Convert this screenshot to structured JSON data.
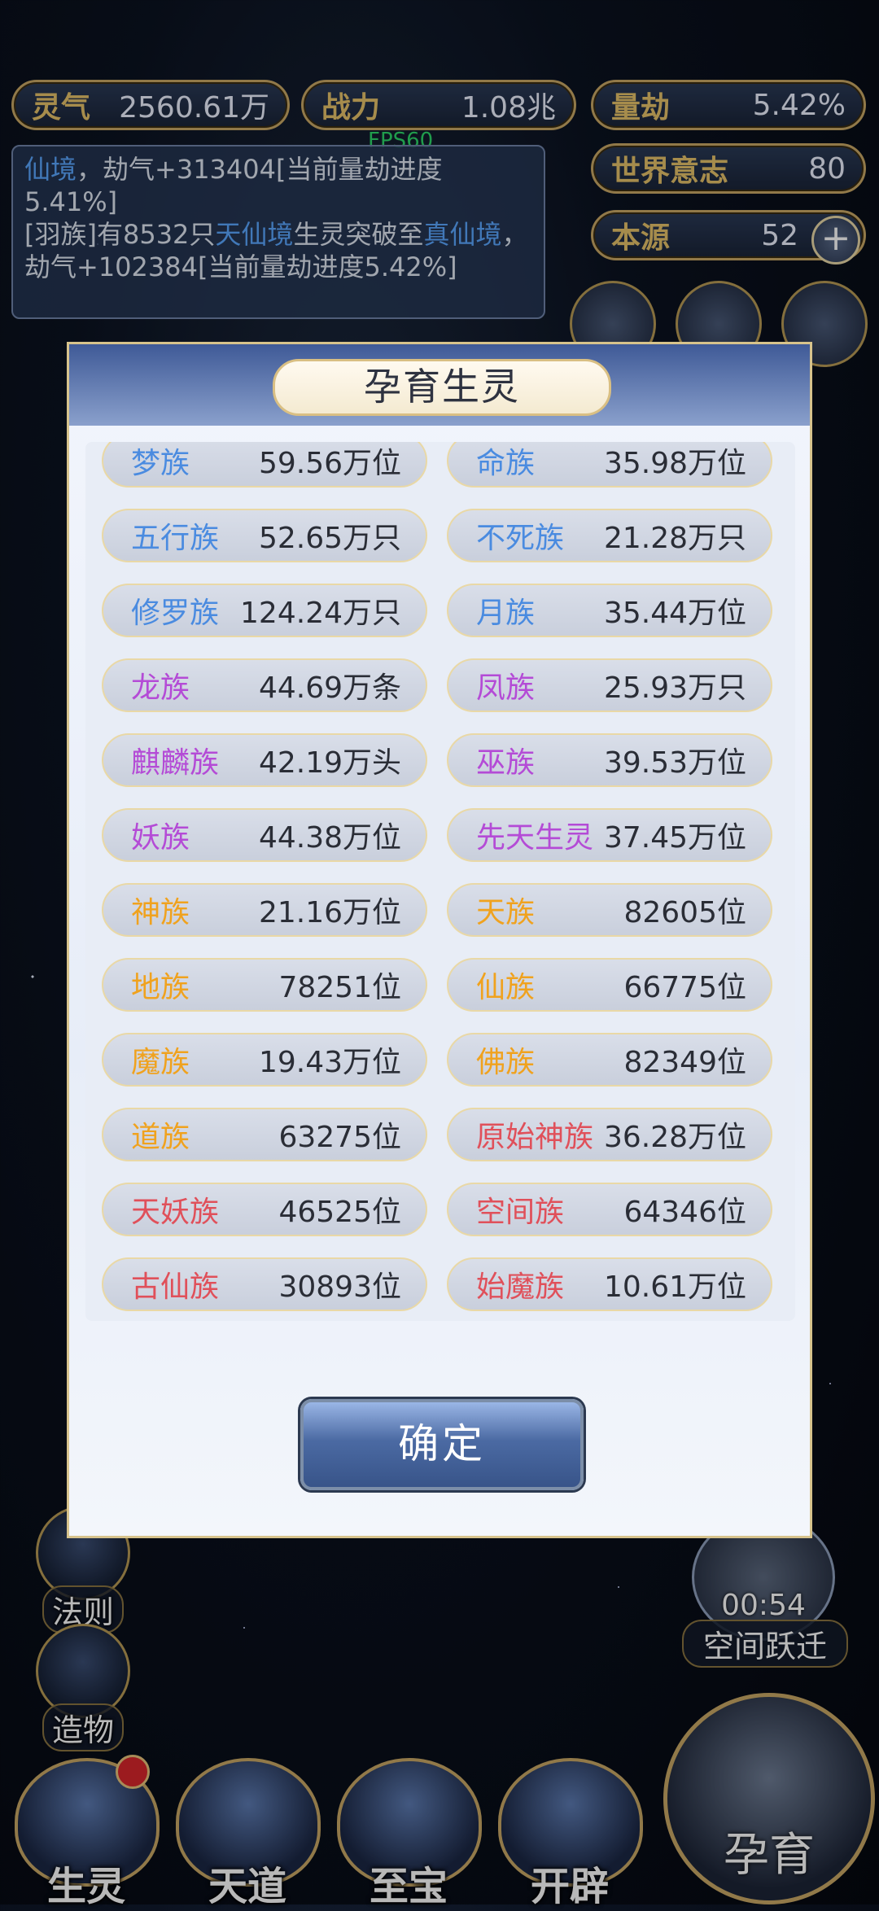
{
  "hud": {
    "lingqi": {
      "label": "灵气",
      "value": "2560.61万"
    },
    "zhanli": {
      "label": "战力",
      "value": "1.08兆"
    },
    "liangjie": {
      "label": "量劫",
      "value": "5.42%"
    },
    "world_will": {
      "label": "世界意志",
      "value": "80"
    },
    "benyuan": {
      "label": "本源",
      "value": "52"
    },
    "plus": "+",
    "fps": "FPS60"
  },
  "log": {
    "line1_prefix": "仙境",
    "line1_rest": "，劫气+313404[当前量劫进度5.41%]",
    "line2_a": "[羽族]有8532只",
    "line2_b": "天仙境",
    "line2_c": "生灵突破至",
    "line2_d": "真仙境",
    "line2_e": "，劫气+102384[当前量劫进度5.42%]"
  },
  "side_menu": {
    "fa_ze": "法则",
    "zao_wu": "造物"
  },
  "bottom_nav": {
    "sheng_ling": "生灵",
    "tian_dao": "天道",
    "zhi_bao": "至宝",
    "kai_pi": "开辟",
    "yun_yu": "孕育"
  },
  "space_jump": {
    "timer": "00:54",
    "label": "空间跃迁"
  },
  "modal": {
    "title": "孕育生灵",
    "confirm": "确定",
    "races": [
      {
        "name": "梦族",
        "count": "59.56万位",
        "color": "#4a8be0"
      },
      {
        "name": "命族",
        "count": "35.98万位",
        "color": "#4a8be0"
      },
      {
        "name": "五行族",
        "count": "52.65万只",
        "color": "#4a8be0"
      },
      {
        "name": "不死族",
        "count": "21.28万只",
        "color": "#4a8be0"
      },
      {
        "name": "修罗族",
        "count": "124.24万只",
        "color": "#4a8be0"
      },
      {
        "name": "月族",
        "count": "35.44万位",
        "color": "#4a8be0"
      },
      {
        "name": "龙族",
        "count": "44.69万条",
        "color": "#b44bd6"
      },
      {
        "name": "凤族",
        "count": "25.93万只",
        "color": "#b44bd6"
      },
      {
        "name": "麒麟族",
        "count": "42.19万头",
        "color": "#b44bd6"
      },
      {
        "name": "巫族",
        "count": "39.53万位",
        "color": "#b44bd6"
      },
      {
        "name": "妖族",
        "count": "44.38万位",
        "color": "#b44bd6"
      },
      {
        "name": "先天生灵",
        "count": "37.45万位",
        "color": "#b44bd6"
      },
      {
        "name": "神族",
        "count": "21.16万位",
        "color": "#f0a21e"
      },
      {
        "name": "天族",
        "count": "82605位",
        "color": "#f0a21e"
      },
      {
        "name": "地族",
        "count": "78251位",
        "color": "#f0a21e"
      },
      {
        "name": "仙族",
        "count": "66775位",
        "color": "#f0a21e"
      },
      {
        "name": "魔族",
        "count": "19.43万位",
        "color": "#f0a21e"
      },
      {
        "name": "佛族",
        "count": "82349位",
        "color": "#f0a21e"
      },
      {
        "name": "道族",
        "count": "63275位",
        "color": "#f0a21e"
      },
      {
        "name": "原始神族",
        "count": "36.28万位",
        "color": "#e0505a"
      },
      {
        "name": "天妖族",
        "count": "46525位",
        "color": "#e0505a"
      },
      {
        "name": "空间族",
        "count": "64346位",
        "color": "#e0505a"
      },
      {
        "name": "古仙族",
        "count": "30893位",
        "color": "#e0505a"
      },
      {
        "name": "始魔族",
        "count": "10.61万位",
        "color": "#e0505a"
      }
    ]
  }
}
